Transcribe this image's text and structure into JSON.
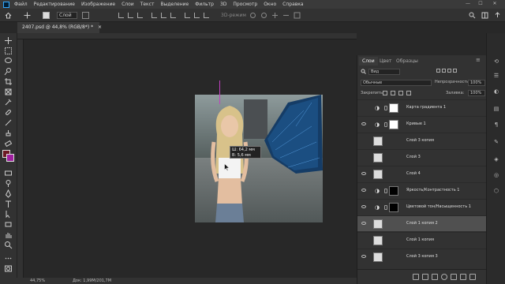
{
  "menubar": {
    "items": [
      "Файл",
      "Редактирование",
      "Изображение",
      "Слои",
      "Текст",
      "Выделение",
      "Фильтр",
      "3D",
      "Просмотр",
      "Окно",
      "Справка"
    ],
    "window_buttons": [
      "—",
      "☐",
      "✕"
    ]
  },
  "options": {
    "auto_select_label": "Слой",
    "mode_3d_label": "3D-режим"
  },
  "document": {
    "tab_title": "2407.psd @ 44,8% (RGB/8*) *",
    "tab_close": "×"
  },
  "canvas": {
    "measure_tip_line1": "Ш: 64,2 мм",
    "measure_tip_line2": "В: 5,6 мм"
  },
  "status": {
    "zoom": "44,75%",
    "doc_size": "Док: 1,99М/201,7М"
  },
  "colors": {
    "foreground": "#a020a0",
    "background": "#6b1a24",
    "accent": "#31a8ff",
    "selection": "#505050"
  },
  "panel_tabs": [
    "Слои",
    "Цвет",
    "Образцы"
  ],
  "layers_panel": {
    "search_value": "Вид",
    "blend_mode": "Обычные",
    "opacity_label": "Непрозрачность:",
    "opacity_value": "100%",
    "lock_label": "Закрепить:",
    "fill_label": "Заливка:",
    "fill_value": "100%",
    "layers": [
      {
        "name": "Карта градиента 1",
        "visible": false,
        "type": "adjustment",
        "icon": "gradient-map-icon"
      },
      {
        "name": "Кривые 1",
        "visible": true,
        "type": "adjustment",
        "icon": "curves-icon"
      },
      {
        "name": "Слой 3 копия",
        "visible": false,
        "type": "pixel",
        "icon": "layer-thumbnail"
      },
      {
        "name": "Слой 3",
        "visible": false,
        "type": "pixel",
        "icon": "layer-thumbnail"
      },
      {
        "name": "Слой 4",
        "visible": true,
        "type": "pixel",
        "icon": "layer-thumbnail"
      },
      {
        "name": "Яркость/Контрастность 1",
        "visible": true,
        "type": "adjustment",
        "icon": "brightness-icon"
      },
      {
        "name": "Цветовой тон/Насыщенность 1",
        "visible": true,
        "type": "adjustment",
        "icon": "hue-saturation-icon"
      },
      {
        "name": "Слой 1 копия 2",
        "visible": true,
        "type": "pixel",
        "icon": "layer-thumbnail",
        "selected": true
      },
      {
        "name": "Слой 1 копия",
        "visible": false,
        "type": "pixel",
        "icon": "layer-thumbnail"
      },
      {
        "name": "Слой 3 копия 3",
        "visible": true,
        "type": "pixel",
        "icon": "layer-thumbnail"
      }
    ]
  }
}
